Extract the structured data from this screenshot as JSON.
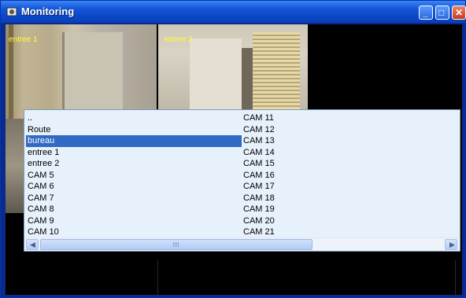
{
  "window": {
    "title": "Monitoring",
    "controls": {
      "minimize": "_",
      "maximize": "□",
      "close": "✕"
    },
    "colors": {
      "titlebar": "#0a47c8",
      "selection": "#316ac5",
      "list_bg": "#e6f1fb",
      "cam_label": "#ffff33"
    }
  },
  "cameras": {
    "feed1_label": "entree 1",
    "feed2_label": "entree 2"
  },
  "list": {
    "column1": [
      "..",
      "Route",
      "bureau",
      "entree 1",
      "entree 2",
      "CAM 5",
      "CAM 6",
      "CAM 7",
      "CAM 8",
      "CAM 9",
      "CAM 10"
    ],
    "column2": [
      "CAM 11",
      "CAM 12",
      "CAM 13",
      "CAM 14",
      "CAM 15",
      "CAM 16",
      "CAM 17",
      "CAM 18",
      "CAM 19",
      "CAM 20",
      "CAM 21"
    ],
    "selected": "bureau"
  },
  "scrollbar": {
    "left_arrow": "◀",
    "right_arrow": "▶"
  }
}
